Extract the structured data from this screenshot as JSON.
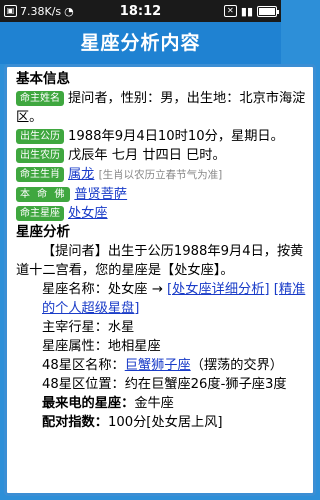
{
  "statusbar": {
    "network_speed": "7.38K/s",
    "time": "18:12"
  },
  "title": "星座分析内容",
  "basic": {
    "heading": "基本信息",
    "name_tag": "命主姓名",
    "name_text": "提问者，性别：男，出生地：北京市海淀区。",
    "solar_tag": "出生公历",
    "solar_text": "1988年9月4日10时10分，星期日。",
    "lunar_tag": "出生农历",
    "lunar_text": "戊辰年 七月 廿四日 巳时。",
    "zodiac_tag": "命主生肖",
    "zodiac_link": "属龙",
    "zodiac_note": "[生肖以农历立春节气为准]",
    "buddha_tag": "本 命 佛",
    "buddha_link": "普贤菩萨",
    "sign_tag": "命主星座",
    "sign_link": "处女座"
  },
  "analysis": {
    "heading": "星座分析",
    "intro": "【提问者】出生于公历1988年9月4日，按黄道十二宫看，您的星座是【处女座】。",
    "sign_name_label": "星座名称：处女座 → ",
    "sign_detail_link": "[处女座详细分析]",
    "horoscope_link": "[精准的个人超级星盘]",
    "ruling_star": "主宰行星：水星",
    "attribute": "星座属性：地相星座",
    "zone48_label": "48星区名称：",
    "zone48_link": "巨蟹狮子座",
    "zone48_suffix": "（摆荡的交界）",
    "zone48_position": "48星区位置：约在巨蟹座26度-狮子座3度",
    "best_match_label": "最来电的星座：",
    "best_match_value": "金牛座",
    "match_index_label": "配对指数：",
    "match_index_value": "100分[处女居上风]"
  }
}
